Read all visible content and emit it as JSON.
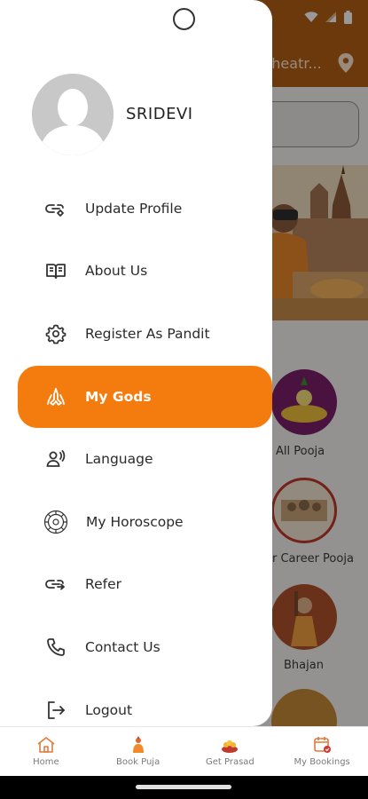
{
  "status_bar": {
    "icons": [
      "wifi-icon",
      "signal-icon",
      "battery-icon"
    ]
  },
  "app": {
    "location_text": "theatr...",
    "categories": [
      {
        "label": "All Pooja"
      },
      {
        "label": "r Career Pooja"
      },
      {
        "label": "Bhajan"
      }
    ]
  },
  "drawer": {
    "user_name": "SRIDEVI",
    "active_item": "My Gods",
    "items": [
      {
        "label": "Update Profile",
        "icon": "profile-edit-icon"
      },
      {
        "label": "About Us",
        "icon": "book-icon"
      },
      {
        "label": "Register As Pandit",
        "icon": "gear-icon"
      },
      {
        "label": "My Gods",
        "icon": "praying-hands-icon"
      },
      {
        "label": "Language",
        "icon": "language-icon"
      },
      {
        "label": "My Horoscope",
        "icon": "horoscope-icon"
      },
      {
        "label": "Refer",
        "icon": "refer-icon"
      },
      {
        "label": "Contact Us",
        "icon": "phone-icon"
      },
      {
        "label": "Logout",
        "icon": "logout-icon"
      }
    ]
  },
  "bottom_nav": {
    "tabs": [
      {
        "label": "Home",
        "icon": "home-icon"
      },
      {
        "label": "Book Puja",
        "icon": "book-puja-icon"
      },
      {
        "label": "Get Prasad",
        "icon": "prasad-icon"
      },
      {
        "label": "My Bookings",
        "icon": "calendar-check-icon"
      }
    ]
  },
  "colors": {
    "accent": "#f47c0e",
    "header": "#b45f14",
    "drawer_bg": "#ffffff"
  }
}
